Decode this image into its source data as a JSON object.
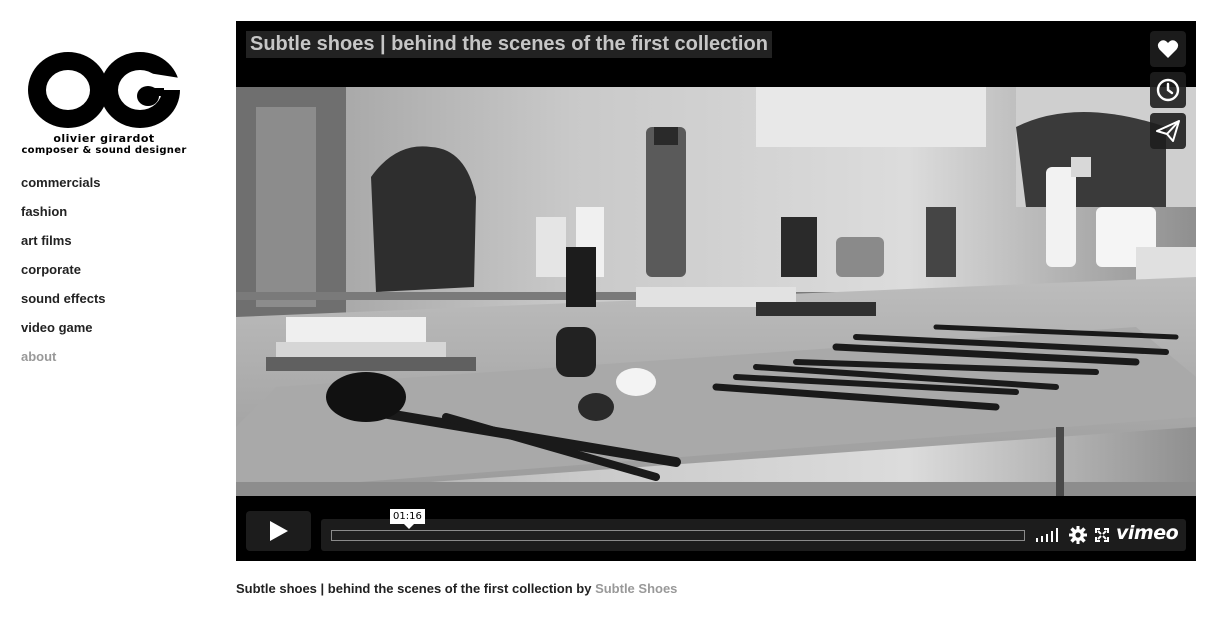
{
  "logo": {
    "line1": "olivier girardot",
    "line2": "composer & sound designer"
  },
  "nav": {
    "items": [
      {
        "label": "commercials"
      },
      {
        "label": "fashion"
      },
      {
        "label": "art films"
      },
      {
        "label": "corporate"
      },
      {
        "label": "sound effects"
      },
      {
        "label": "video game"
      },
      {
        "label": "about"
      }
    ]
  },
  "player": {
    "title": "Subtle shoes | behind the scenes of the first collection",
    "timecode": "01:16",
    "brand": "vimeo",
    "side_buttons": [
      "heart-icon",
      "clock-icon",
      "paper-plane-icon"
    ]
  },
  "caption": {
    "text": "Subtle shoes | behind the scenes of the first collection by",
    "author": "Subtle Shoes"
  },
  "colors": {
    "muted_link": "#999999",
    "player_bg": "#000000"
  }
}
